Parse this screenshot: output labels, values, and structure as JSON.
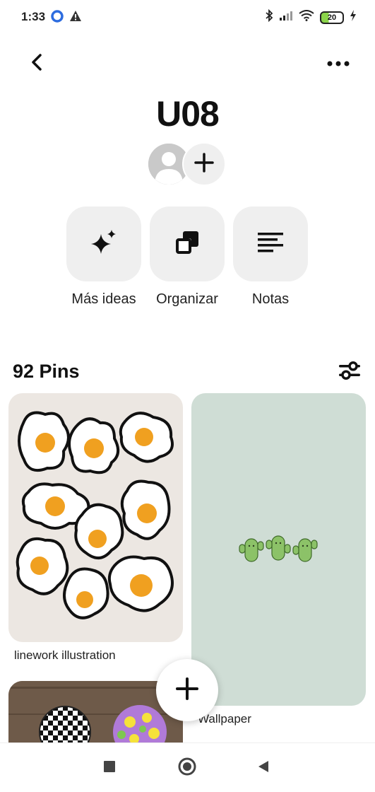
{
  "status_bar": {
    "time": "1:33",
    "battery": "20",
    "left_icons": [
      "app-notification-icon",
      "warning-icon"
    ],
    "right_icons": [
      "bluetooth-icon",
      "signal-icon",
      "wifi-icon",
      "battery-icon",
      "charging-icon"
    ]
  },
  "board": {
    "title": "U08"
  },
  "actions": [
    {
      "label": "Más ideas",
      "icon": "sparkle-icon"
    },
    {
      "label": "Organizar",
      "icon": "organize-icon"
    },
    {
      "label": "Notas",
      "icon": "notes-icon"
    }
  ],
  "pins_section": {
    "count_label": "92 Pins"
  },
  "pins": [
    {
      "title": "linework illustration"
    },
    {
      "title": "Wallpaper"
    },
    {
      "title": ""
    }
  ],
  "colors": {
    "background": "#ffffff",
    "action_bg": "#efefef",
    "pin1_bg": "#ece7e2",
    "pin2_bg": "#cfddd5",
    "egg_yolk": "#f0a020",
    "cactus_green": "#8cc268"
  }
}
